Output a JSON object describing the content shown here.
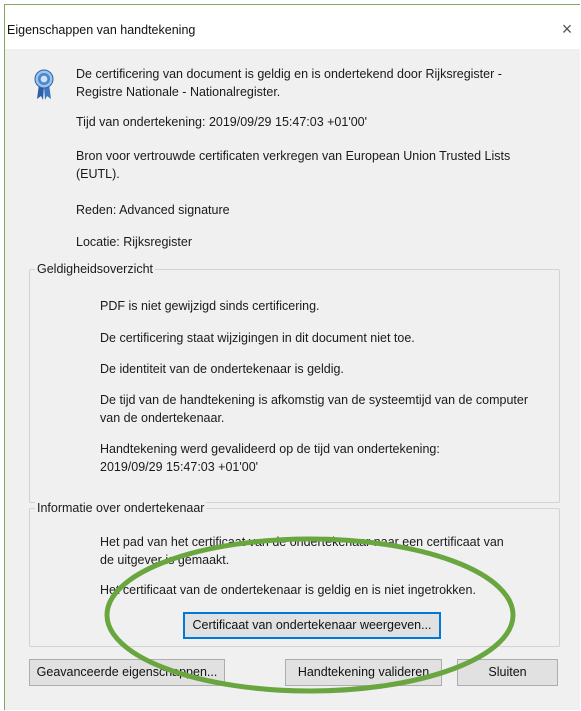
{
  "window": {
    "title": "Eigenschappen van handtekening",
    "close_symbol": "×"
  },
  "summary": {
    "icon": "certificate-ribbon-icon",
    "certified_by": "De certificering van document is geldig en is ondertekend door Rijksregister - Registre Nationale - Nationalregister.",
    "signing_time": "Tijd van ondertekening:  2019/09/29 15:47:03 +01'00'",
    "trusted_source": "Bron voor vertrouwde certificaten verkregen van European Union Trusted Lists (EUTL).",
    "reason": "Reden:  Advanced signature",
    "location": "Locatie:  Rijksregister"
  },
  "validity": {
    "title": "Geldigheidsoverzicht",
    "items": [
      "PDF is niet gewijzigd sinds certificering.",
      "De certificering staat wijzigingen in dit document niet toe.",
      "De identiteit van de ondertekenaar is geldig.",
      "De tijd van de handtekening is afkomstig van de systeemtijd van de computer van de ondertekenaar.",
      "Handtekening werd gevalideerd op de tijd van ondertekening: 2019/09/29 15:47:03 +01'00'"
    ]
  },
  "signer_info": {
    "title": "Informatie over ondertekenaar",
    "path_text": "Het pad van het certificaat van de ondertekenaar naar een certificaat van de uitgever is gemaakt.",
    "valid_text": "Het certificaat van de ondertekenaar is geldig en is niet ingetrokken.",
    "show_certificate_button": "Certificaat van ondertekenaar weergeven..."
  },
  "footer": {
    "advanced_button": "Geavanceerde eigenschappen...",
    "validate_button": "Handtekening valideren",
    "close_button": "Sluiten"
  },
  "colors": {
    "annotation_ellipse": "#6aa640",
    "focus_border": "#0078d7",
    "seal_blue": "#3a78c2"
  }
}
